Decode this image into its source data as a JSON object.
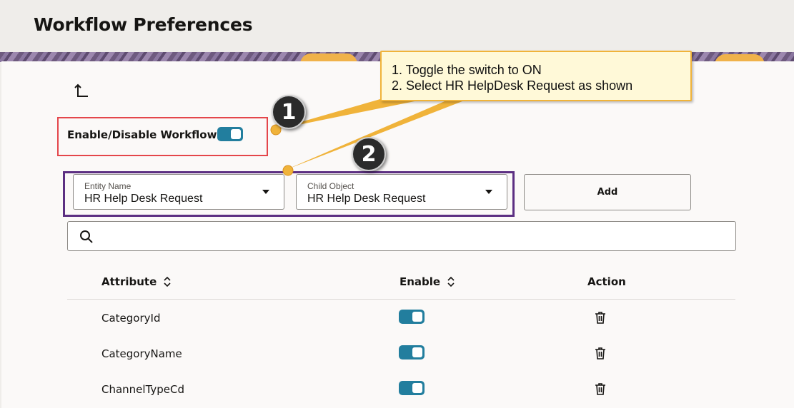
{
  "header": {
    "title": "Workflow Preferences"
  },
  "workflow": {
    "label": "Enable/Disable Workflow",
    "enabled": true
  },
  "filters": {
    "entity": {
      "label": "Entity Name",
      "value": "HR Help Desk Request"
    },
    "child": {
      "label": "Child Object",
      "value": "HR Help Desk Request"
    },
    "add_label": "Add"
  },
  "search": {
    "placeholder": "",
    "value": ""
  },
  "table": {
    "columns": [
      "Attribute",
      "Enable",
      "Action"
    ],
    "rows": [
      {
        "attribute": "CategoryId",
        "enabled": true
      },
      {
        "attribute": "CategoryName",
        "enabled": true
      },
      {
        "attribute": "ChannelTypeCd",
        "enabled": true
      }
    ]
  },
  "callout": {
    "line1": "1. Toggle the switch to ON",
    "line2": "2. Select HR HelpDesk Request as shown"
  },
  "markers": [
    "1",
    "2"
  ],
  "colors": {
    "accent": "#227e9e",
    "highlight_red": "#e4464b",
    "highlight_purple": "#5c2f82",
    "callout_border": "#f0b33a"
  }
}
